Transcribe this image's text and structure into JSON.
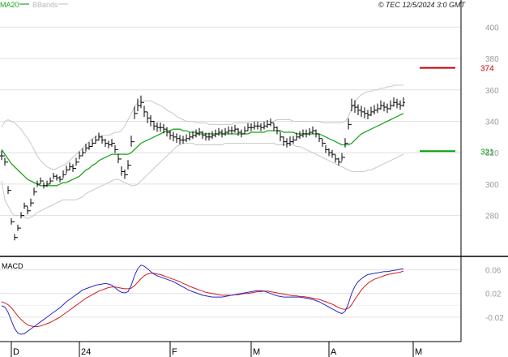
{
  "header": {
    "legend_ma": "MA20",
    "legend_bbands": "BBands",
    "copyright": "© TEC 12/5/2024 3:0 GMT"
  },
  "colors": {
    "ma": "#1fa51f",
    "bbands": "#c8c8c8",
    "bars": "#000000",
    "macd_line": "#2828c8",
    "signal_line": "#d21e1e",
    "resistance": "#c80000",
    "support": "#00a000",
    "grid": "#e0e0e0",
    "axis_text": "#9a9a9a"
  },
  "chart_data": [
    {
      "type": "ohlc",
      "name": "price",
      "ylim": [
        255,
        410
      ],
      "y_ticks": [
        "280",
        "300",
        "320",
        "340",
        "360",
        "380",
        "400"
      ],
      "x_labels": [
        "D",
        "24",
        "F",
        "M",
        "A",
        "M"
      ],
      "x_label_index": [
        2,
        23,
        51,
        76,
        100,
        126
      ],
      "n_bars": 130,
      "levels": [
        {
          "name": "resistance",
          "value": 374,
          "label": "374"
        },
        {
          "name": "support",
          "value": 321,
          "label": "321"
        }
      ],
      "close": [
        318,
        314,
        296,
        276,
        266,
        272,
        280,
        286,
        283,
        288,
        295,
        300,
        302,
        299,
        300,
        302,
        305,
        304,
        303,
        306,
        309,
        311,
        310,
        314,
        318,
        320,
        323,
        324,
        326,
        328,
        330,
        328,
        326,
        325,
        326,
        322,
        316,
        308,
        306,
        312,
        327,
        345,
        350,
        352,
        346,
        342,
        340,
        337,
        336,
        336,
        335,
        333,
        331,
        330,
        329,
        328,
        328,
        329,
        330,
        331,
        332,
        333,
        331,
        330,
        330,
        331,
        332,
        333,
        332,
        333,
        334,
        334,
        335,
        333,
        332,
        334,
        336,
        336,
        337,
        337,
        336,
        337,
        338,
        339,
        336,
        334,
        330,
        327,
        326,
        327,
        328,
        330,
        331,
        332,
        332,
        333,
        334,
        332,
        329,
        326,
        322,
        320,
        319,
        316,
        314,
        317,
        326,
        338,
        350,
        349,
        347,
        346,
        345,
        344,
        346,
        347,
        348,
        350,
        349,
        348,
        350,
        352,
        351,
        350,
        352
      ],
      "ohlc_range": [
        6,
        5,
        5,
        4,
        4,
        4,
        4,
        4,
        5,
        5,
        5,
        4,
        4,
        4,
        4,
        4,
        4,
        4,
        4,
        5,
        5,
        5,
        5,
        5,
        5,
        5,
        5,
        5,
        5,
        5,
        5,
        5,
        5,
        5,
        5,
        5,
        6,
        6,
        6,
        6,
        7,
        8,
        8,
        8,
        7,
        7,
        7,
        6,
        6,
        6,
        6,
        6,
        6,
        6,
        6,
        6,
        5,
        5,
        5,
        5,
        5,
        5,
        5,
        5,
        5,
        5,
        5,
        5,
        5,
        5,
        5,
        5,
        5,
        5,
        5,
        5,
        5,
        5,
        5,
        5,
        5,
        5,
        5,
        5,
        5,
        5,
        6,
        6,
        6,
        6,
        5,
        5,
        5,
        5,
        5,
        5,
        5,
        5,
        5,
        5,
        5,
        5,
        5,
        5,
        5,
        5,
        6,
        7,
        8,
        8,
        7,
        7,
        7,
        6,
        6,
        6,
        6,
        6,
        6,
        6,
        6,
        6,
        6,
        6,
        6
      ],
      "ma20": [
        322,
        319,
        316,
        313,
        311,
        309,
        307,
        305,
        303,
        302,
        301,
        300,
        299,
        299,
        299,
        299,
        299,
        299,
        300,
        301,
        301,
        302,
        303,
        304,
        305,
        307,
        309,
        310,
        312,
        313,
        315,
        316,
        317,
        318,
        319,
        319,
        319,
        319,
        319,
        319,
        320,
        322,
        324,
        326,
        327,
        328,
        329,
        330,
        331,
        332,
        333,
        334,
        334,
        335,
        335,
        335,
        334,
        334,
        333,
        333,
        333,
        332,
        332,
        332,
        332,
        332,
        332,
        332,
        332,
        332,
        332,
        332,
        332,
        332,
        332,
        332,
        332,
        333,
        333,
        333,
        333,
        333,
        334,
        334,
        334,
        334,
        334,
        333,
        333,
        333,
        333,
        332,
        332,
        332,
        332,
        332,
        332,
        332,
        332,
        331,
        330,
        329,
        328,
        327,
        326,
        325,
        325,
        325,
        326,
        328,
        330,
        332,
        333,
        334,
        335,
        336,
        337,
        338,
        339,
        340,
        341,
        342,
        343,
        344,
        345
      ],
      "bb_upper": [
        336,
        340,
        341,
        340,
        339,
        337,
        335,
        332,
        329,
        326,
        322,
        318,
        315,
        313,
        311,
        310,
        309,
        310,
        311,
        312,
        313,
        315,
        317,
        319,
        321,
        323,
        325,
        327,
        329,
        330,
        331,
        331,
        331,
        331,
        332,
        333,
        333,
        334,
        337,
        341,
        345,
        349,
        352,
        353,
        353,
        353,
        353,
        352,
        351,
        350,
        349,
        347,
        346,
        345,
        343,
        342,
        341,
        340,
        340,
        340,
        339,
        339,
        339,
        339,
        338,
        338,
        338,
        338,
        338,
        338,
        338,
        338,
        339,
        339,
        339,
        339,
        339,
        340,
        340,
        340,
        340,
        340,
        340,
        340,
        340,
        341,
        341,
        341,
        341,
        341,
        340,
        340,
        340,
        340,
        340,
        340,
        340,
        340,
        340,
        339,
        339,
        339,
        339,
        339,
        339,
        339,
        340,
        343,
        348,
        352,
        355,
        357,
        358,
        359,
        359,
        360,
        360,
        361,
        361,
        362,
        362,
        363,
        363,
        363,
        363
      ],
      "bb_lower": [
        302,
        290,
        286,
        282,
        280,
        280,
        280,
        279,
        278,
        279,
        280,
        282,
        283,
        284,
        285,
        286,
        287,
        288,
        289,
        290,
        290,
        290,
        290,
        290,
        291,
        292,
        294,
        295,
        296,
        297,
        298,
        299,
        300,
        301,
        302,
        303,
        303,
        302,
        301,
        300,
        299,
        299,
        300,
        302,
        304,
        306,
        308,
        310,
        312,
        314,
        316,
        318,
        320,
        322,
        324,
        325,
        326,
        326,
        326,
        326,
        325,
        325,
        325,
        325,
        325,
        325,
        325,
        325,
        325,
        326,
        326,
        326,
        326,
        326,
        326,
        326,
        326,
        326,
        326,
        326,
        326,
        326,
        326,
        326,
        326,
        325,
        325,
        325,
        325,
        325,
        325,
        324,
        324,
        323,
        322,
        321,
        320,
        319,
        318,
        317,
        316,
        315,
        314,
        313,
        312,
        311,
        310,
        309,
        308,
        308,
        308,
        308,
        308,
        309,
        309,
        310,
        311,
        312,
        313,
        314,
        315,
        316,
        317,
        318,
        319
      ]
    },
    {
      "type": "line",
      "name": "MACD",
      "title": "MACD",
      "ylim": [
        -6,
        8
      ],
      "y_ticks": [
        "-0.02",
        "0.02",
        "0.06"
      ],
      "series": [
        {
          "name": "MACD",
          "values": [
            -0.1,
            -0.3,
            -1.2,
            -2.6,
            -3.9,
            -4.7,
            -4.9,
            -4.8,
            -4.4,
            -4.0,
            -3.6,
            -3.2,
            -2.8,
            -2.4,
            -2.0,
            -1.6,
            -1.2,
            -0.8,
            -0.4,
            0.1,
            0.6,
            1.0,
            1.4,
            1.8,
            2.2,
            2.6,
            2.8,
            3.0,
            3.2,
            3.4,
            3.5,
            3.6,
            3.7,
            3.6,
            3.4,
            3.0,
            2.5,
            2.2,
            2.1,
            2.3,
            3.4,
            5.0,
            6.2,
            6.8,
            6.6,
            6.2,
            5.7,
            5.3,
            5.0,
            4.8,
            4.6,
            4.4,
            4.2,
            4.0,
            3.7,
            3.4,
            3.1,
            2.8,
            2.5,
            2.3,
            2.1,
            1.9,
            1.7,
            1.6,
            1.5,
            1.4,
            1.4,
            1.4,
            1.4,
            1.5,
            1.6,
            1.7,
            1.8,
            1.9,
            2.0,
            2.1,
            2.2,
            2.3,
            2.4,
            2.5,
            2.5,
            2.4,
            2.2,
            2.0,
            1.8,
            1.6,
            1.5,
            1.4,
            1.4,
            1.4,
            1.4,
            1.4,
            1.4,
            1.3,
            1.2,
            1.1,
            1.0,
            0.8,
            0.6,
            0.3,
            0.0,
            -0.3,
            -0.6,
            -0.9,
            -1.2,
            -1.4,
            -1.0,
            0.3,
            2.0,
            3.2,
            4.0,
            4.5,
            4.9,
            5.2,
            5.3,
            5.4,
            5.5,
            5.6,
            5.7,
            5.7,
            5.8,
            5.9,
            6.0,
            6.1,
            6.2
          ]
        },
        {
          "name": "Signal",
          "values": [
            0.6,
            0.4,
            0.1,
            -0.4,
            -1.1,
            -1.8,
            -2.4,
            -2.9,
            -3.3,
            -3.5,
            -3.6,
            -3.6,
            -3.5,
            -3.3,
            -3.1,
            -2.9,
            -2.6,
            -2.3,
            -2.0,
            -1.6,
            -1.2,
            -0.8,
            -0.4,
            0.0,
            0.4,
            0.8,
            1.2,
            1.5,
            1.8,
            2.1,
            2.4,
            2.6,
            2.8,
            3.0,
            3.1,
            3.1,
            3.0,
            2.9,
            2.8,
            2.8,
            2.9,
            3.3,
            3.9,
            4.5,
            5.0,
            5.3,
            5.4,
            5.4,
            5.3,
            5.2,
            5.0,
            4.8,
            4.6,
            4.4,
            4.2,
            4.0,
            3.7,
            3.5,
            3.2,
            3.0,
            2.8,
            2.6,
            2.4,
            2.2,
            2.1,
            2.0,
            1.9,
            1.8,
            1.7,
            1.7,
            1.7,
            1.7,
            1.8,
            1.8,
            1.9,
            2.0,
            2.0,
            2.1,
            2.2,
            2.3,
            2.3,
            2.4,
            2.4,
            2.3,
            2.2,
            2.1,
            2.0,
            1.9,
            1.8,
            1.7,
            1.6,
            1.6,
            1.5,
            1.5,
            1.4,
            1.3,
            1.2,
            1.1,
            1.0,
            0.8,
            0.6,
            0.4,
            0.2,
            -0.1,
            -0.4,
            -0.6,
            -0.7,
            -0.5,
            0.1,
            1.0,
            1.8,
            2.6,
            3.2,
            3.7,
            4.1,
            4.4,
            4.6,
            4.8,
            5.0,
            5.2,
            5.3,
            5.4,
            5.5,
            5.6,
            5.8
          ]
        }
      ]
    }
  ]
}
